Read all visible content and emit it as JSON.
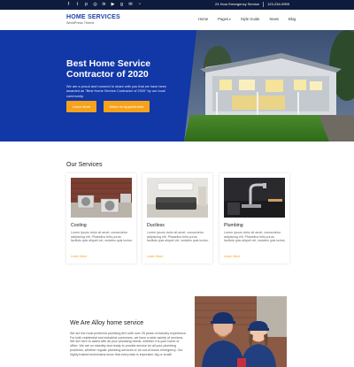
{
  "topbar": {
    "social_icons": [
      "facebook-icon",
      "twitter-icon",
      "pinterest-icon",
      "instagram-icon",
      "linkedin-icon",
      "youtube-icon",
      "google-plus-icon",
      "email-icon",
      "rss-icon"
    ],
    "emergency": "24 Hour Emergency Service",
    "phone": "123-234-9999"
  },
  "header": {
    "title": "HOME SERVICES",
    "subtitle": "WordPress Theme",
    "nav": [
      "Home",
      "Pages",
      "Style Guide",
      "News",
      "Blog"
    ]
  },
  "hero": {
    "title": "Best Home Service Contractor of 2020",
    "description": "We are a proud and honored to share with you that we have been awarded as \"Best Home Service Contractor of 2020\" by our local community.",
    "button_primary": "Learn More",
    "button_secondary": "Make an Appointment"
  },
  "services": {
    "title": "Our Services",
    "items": [
      {
        "title": "Cooling",
        "desc": "Lorem ipsum dolor sit amet, consectetur adipiscing elit. Phasellus felis purus, facilisis quis aliquet vel, sodales quis luctus.",
        "link": "Learn More"
      },
      {
        "title": "Ductless",
        "desc": "Lorem ipsum dolor sit amet, consectetur adipiscing elit. Phasellus felis purus, facilisis quis aliquet vel, sodales quis luctus.",
        "link": "Learn More"
      },
      {
        "title": "Plumbing",
        "desc": "Lorem ipsum dolor sit amet, consectetur adipiscing elit. Phasellus felis purus, facilisis quis aliquet vel, sodales quis luctus.",
        "link": "Learn More"
      }
    ]
  },
  "about": {
    "title": "We Are Alloy home service",
    "text": "We are the most preferred plumbing firm with over 25 years of industry experience. For both residential and industrial customers, we have a wide variety of services. We are here to assist with all your plumbing needs, whether it is your home or office. We are on standby and ready to provide service for all your plumbing problems, whether regular plumbing services or an out-of-hours emergency. Our highly trained technicians know that every task is important, big or small!"
  },
  "colors": {
    "topbar": "#0e1b3d",
    "brand": "#1e3fa8",
    "hero_blue": "#1237a6",
    "accent": "#f6a21c"
  }
}
